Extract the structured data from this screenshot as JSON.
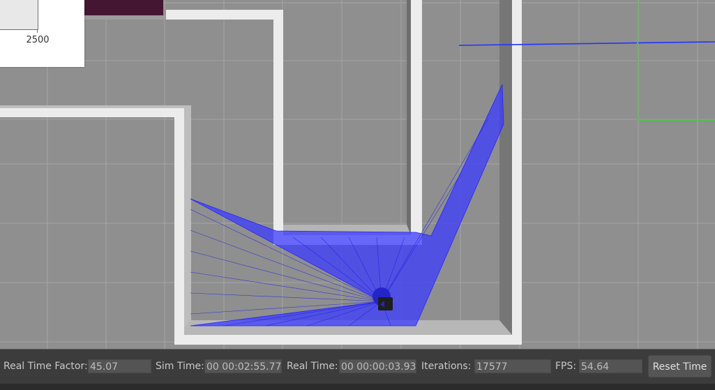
{
  "plot": {
    "tick_label": "2500"
  },
  "toolbar": {
    "real_time_factor_label": "Real Time Factor:",
    "real_time_factor_value": "45.07",
    "sim_time_label": "Sim Time:",
    "sim_time_value": "00 00:02:55.770",
    "real_time_label": "Real Time:",
    "real_time_value": "00 00:00:03.931",
    "iterations_label": "Iterations:",
    "iterations_value": "17577",
    "fps_label": "FPS:",
    "fps_value": "54.64",
    "reset_button_label": "Reset Time"
  },
  "colors": {
    "ground": "#8f8f8f",
    "wall": "#ececec",
    "laser": "#2a2aff",
    "toolbar": "#3c3c3c",
    "grid": "#a6a6a6"
  }
}
